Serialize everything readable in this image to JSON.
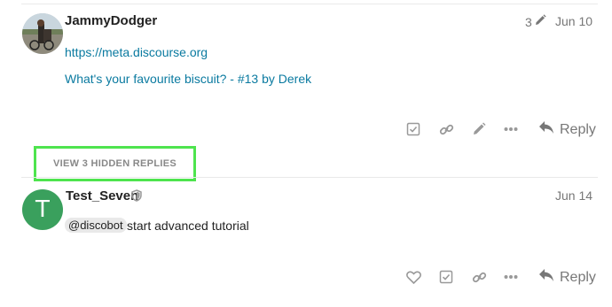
{
  "post1": {
    "username": "JammyDodger",
    "edit_count": "3",
    "date": "Jun 10",
    "link1": "https://meta.discourse.org",
    "link2": "What's your favourite biscuit? - #13 by Derek",
    "reply_label": "Reply"
  },
  "hidden_replies": {
    "label": "VIEW 3 HIDDEN REPLIES"
  },
  "post2": {
    "avatar_letter": "T",
    "username": "Test_Seven",
    "date": "Jun 14",
    "mention": "@discobot",
    "text": "start advanced tutorial",
    "reply_label": "Reply"
  },
  "colors": {
    "link": "#0a7aa0",
    "avatar_bg": "#3aa05d",
    "highlight_border": "#4ee44e",
    "icon_gray": "#999999"
  }
}
